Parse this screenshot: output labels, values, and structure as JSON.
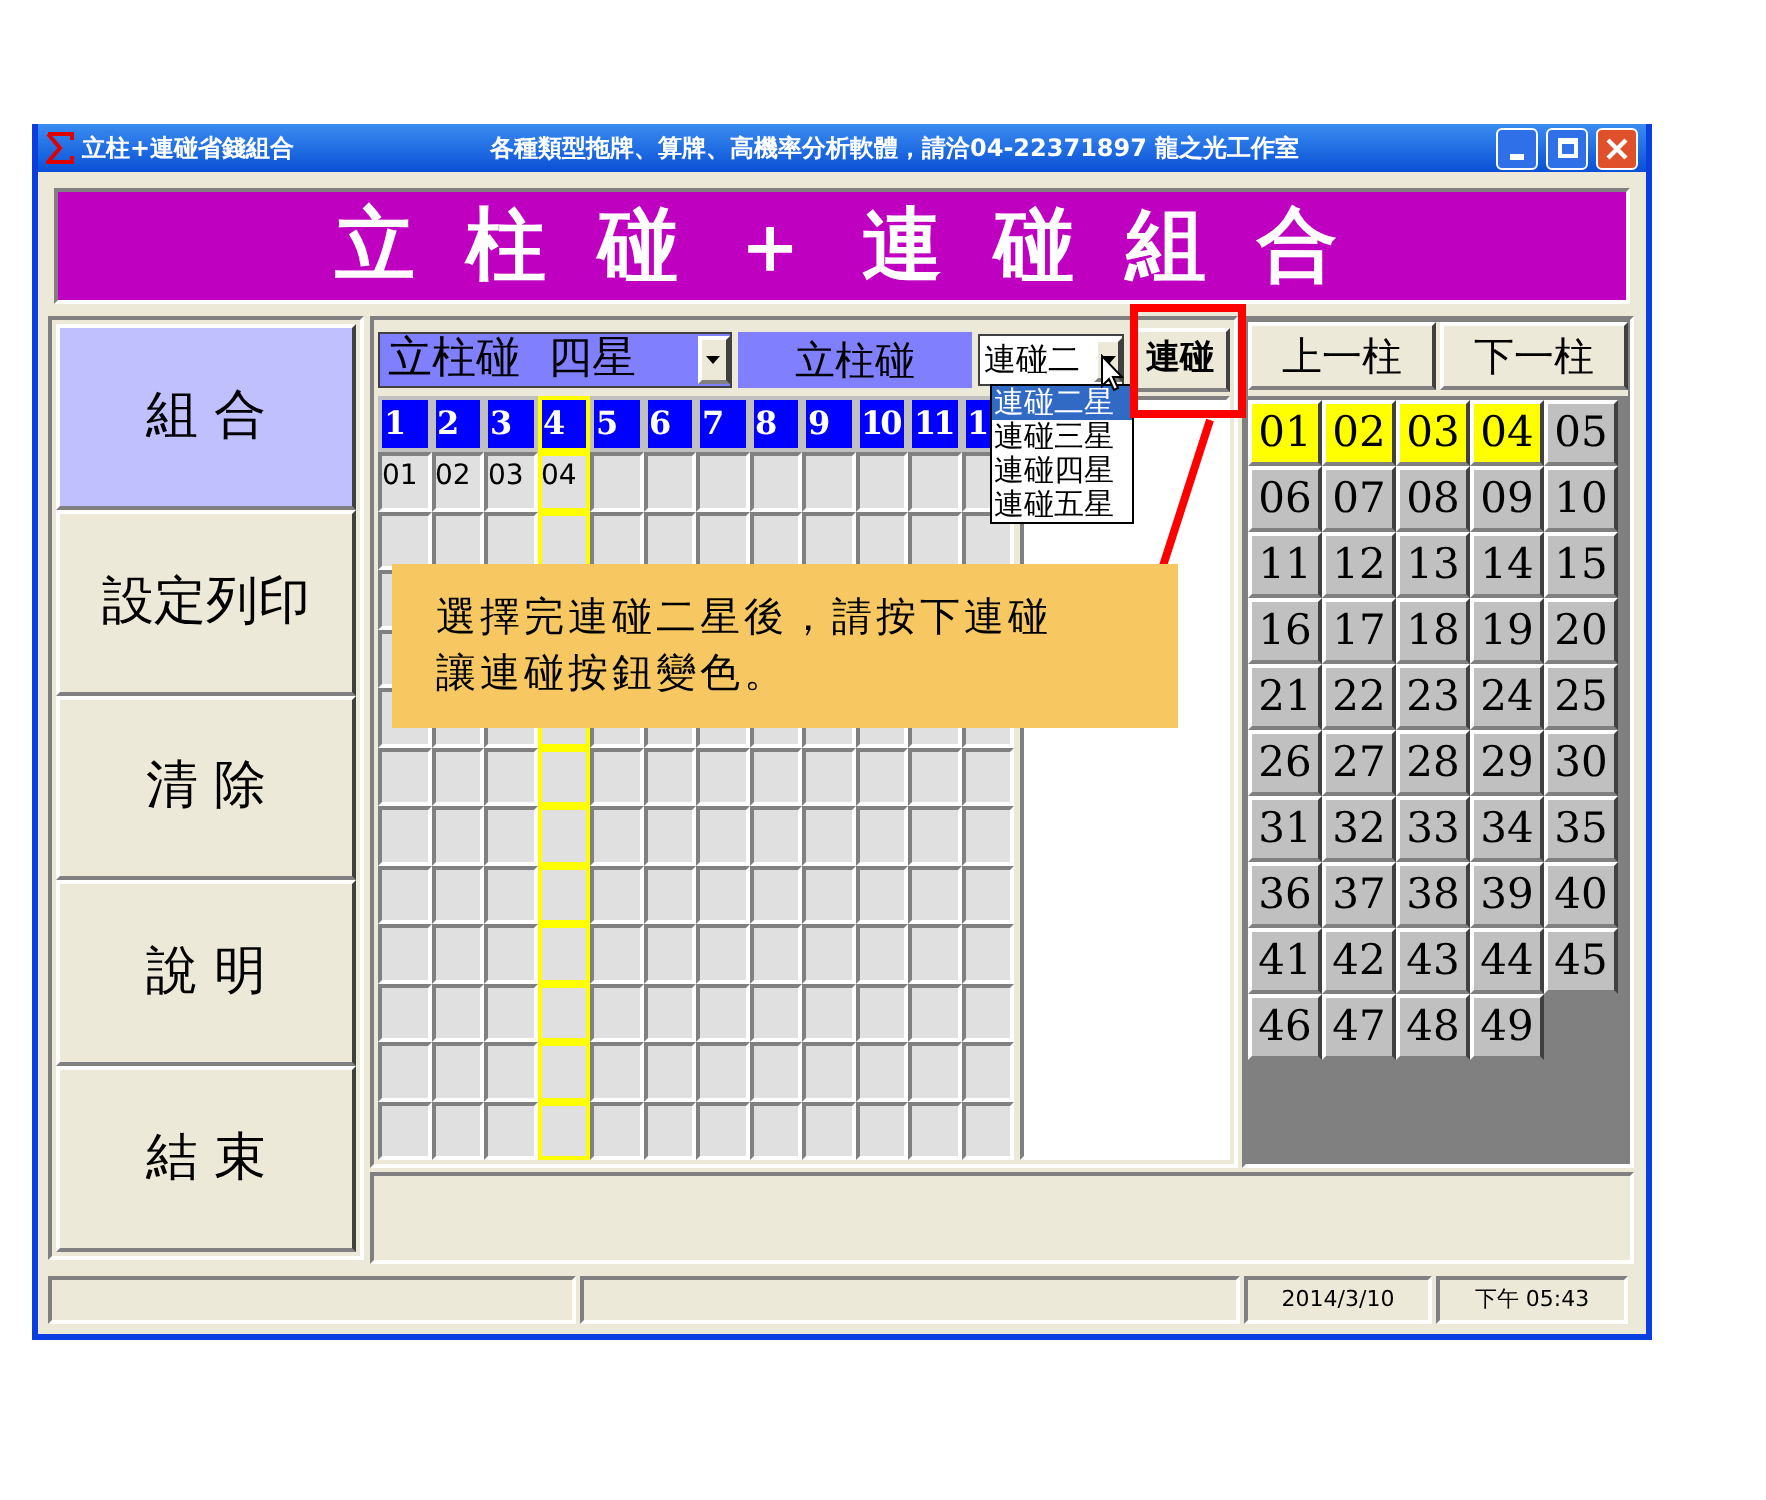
{
  "window": {
    "title": "立柱+連碰省錢組合",
    "caption": "各種類型拖牌、算牌、高機率分析軟體，請洽04-22371897 龍之光工作室"
  },
  "banner": "立 柱 碰 ＋ 連 碰 組 合",
  "menu": [
    {
      "label": "組 合",
      "selected": true
    },
    {
      "label": "設定列印",
      "selected": false
    },
    {
      "label": "清 除",
      "selected": false
    },
    {
      "label": "說 明",
      "selected": false
    },
    {
      "label": "結 束",
      "selected": false
    }
  ],
  "toolbar": {
    "pillar_select": {
      "value": "立柱碰  四星"
    },
    "pillar_label": "立柱碰",
    "combo_select": {
      "value": "連碰二",
      "expanded": true,
      "options": [
        {
          "label": "連碰二星",
          "selected": true
        },
        {
          "label": "連碰三星",
          "selected": false
        },
        {
          "label": "連碰四星",
          "selected": false
        },
        {
          "label": "連碰五星",
          "selected": false
        }
      ]
    },
    "combo_button": "連碰"
  },
  "columns": [
    {
      "label": "1",
      "selected": false
    },
    {
      "label": "2",
      "selected": false
    },
    {
      "label": "3",
      "selected": false
    },
    {
      "label": "4",
      "selected": true
    },
    {
      "label": "5",
      "selected": false
    },
    {
      "label": "6",
      "selected": false
    },
    {
      "label": "7",
      "selected": false
    },
    {
      "label": "8",
      "selected": false
    },
    {
      "label": "9",
      "selected": false
    },
    {
      "label": "10",
      "selected": false
    },
    {
      "label": "11",
      "selected": false
    },
    {
      "label": "1",
      "selected": false
    }
  ],
  "grid": {
    "cells": [
      "01",
      "02",
      "03",
      "04"
    ]
  },
  "nav_buttons": [
    "上一柱",
    "下一柱"
  ],
  "numbers": [
    {
      "label": "01",
      "selected": true
    },
    {
      "label": "02",
      "selected": true
    },
    {
      "label": "03",
      "selected": true
    },
    {
      "label": "04",
      "selected": true
    },
    {
      "label": "05",
      "selected": false
    },
    {
      "label": "06",
      "selected": false
    },
    {
      "label": "07",
      "selected": false
    },
    {
      "label": "08",
      "selected": false
    },
    {
      "label": "09",
      "selected": false
    },
    {
      "label": "10",
      "selected": false
    },
    {
      "label": "11",
      "selected": false
    },
    {
      "label": "12",
      "selected": false
    },
    {
      "label": "13",
      "selected": false
    },
    {
      "label": "14",
      "selected": false
    },
    {
      "label": "15",
      "selected": false
    },
    {
      "label": "16",
      "selected": false
    },
    {
      "label": "17",
      "selected": false
    },
    {
      "label": "18",
      "selected": false
    },
    {
      "label": "19",
      "selected": false
    },
    {
      "label": "20",
      "selected": false
    },
    {
      "label": "21",
      "selected": false
    },
    {
      "label": "22",
      "selected": false
    },
    {
      "label": "23",
      "selected": false
    },
    {
      "label": "24",
      "selected": false
    },
    {
      "label": "25",
      "selected": false
    },
    {
      "label": "26",
      "selected": false
    },
    {
      "label": "27",
      "selected": false
    },
    {
      "label": "28",
      "selected": false
    },
    {
      "label": "29",
      "selected": false
    },
    {
      "label": "30",
      "selected": false
    },
    {
      "label": "31",
      "selected": false
    },
    {
      "label": "32",
      "selected": false
    },
    {
      "label": "33",
      "selected": false
    },
    {
      "label": "34",
      "selected": false
    },
    {
      "label": "35",
      "selected": false
    },
    {
      "label": "36",
      "selected": false
    },
    {
      "label": "37",
      "selected": false
    },
    {
      "label": "38",
      "selected": false
    },
    {
      "label": "39",
      "selected": false
    },
    {
      "label": "40",
      "selected": false
    },
    {
      "label": "41",
      "selected": false
    },
    {
      "label": "42",
      "selected": false
    },
    {
      "label": "43",
      "selected": false
    },
    {
      "label": "44",
      "selected": false
    },
    {
      "label": "45",
      "selected": false
    },
    {
      "label": "46",
      "selected": false
    },
    {
      "label": "47",
      "selected": false
    },
    {
      "label": "48",
      "selected": false
    },
    {
      "label": "49",
      "selected": false
    }
  ],
  "callout": {
    "lines": [
      "選擇完連碰二星後，請按下連碰",
      "讓連碰按鈕變色。"
    ]
  },
  "status_bar": [
    "2014/3/10",
    "下午 05:43"
  ]
}
